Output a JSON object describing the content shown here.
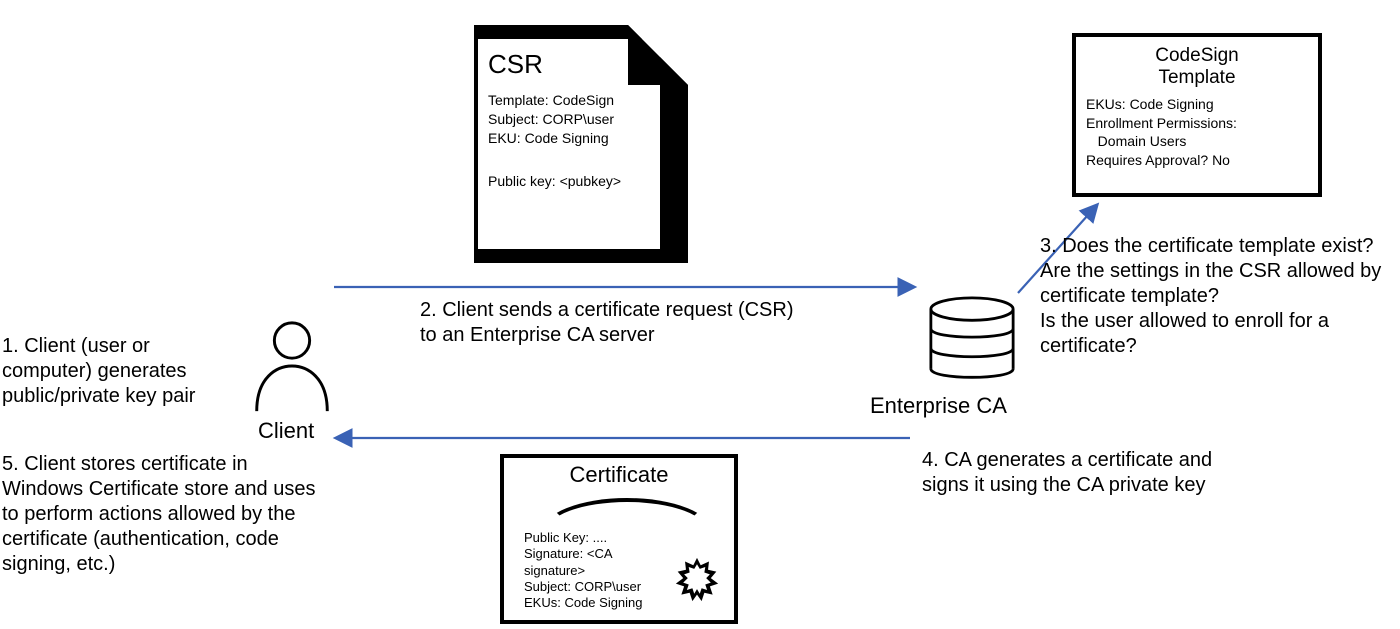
{
  "csr": {
    "title": "CSR",
    "template_line": "Template: CodeSign",
    "subject_line": "Subject: CORP\\user",
    "eku_line": "EKU: Code Signing",
    "pubkey_line": "Public key: <pubkey>"
  },
  "template_box": {
    "title_line1": "CodeSign",
    "title_line2": "Template",
    "eku_line": "EKUs: Code Signing",
    "perm_line1": "Enrollment Permissions:",
    "perm_line2": "   Domain Users",
    "approval_line": "Requires Approval? No"
  },
  "client_label": "Client",
  "ca_label": "Enterprise CA",
  "steps": {
    "s1": "1. Client (user or computer) generates public/private key pair",
    "s2": "2. Client sends a certificate request (CSR) to an Enterprise CA server",
    "s3a": "3. Does the certificate template exist?",
    "s3b": "Are the settings in the CSR allowed by certificate template?",
    "s3c": "Is the user allowed to enroll for a certificate?",
    "s4": "4. CA generates a certificate and signs it using the CA private key",
    "s5": "5. Client stores certificate in Windows Certificate store and uses to perform actions allowed by the certificate (authentication, code signing, etc.)"
  },
  "certificate": {
    "title": "Certificate",
    "pubkey_line": "Public Key: ....",
    "sig_line1": "Signature: <CA",
    "sig_line2": "signature>",
    "subject_line": "Subject: CORP\\user",
    "eku_line": "EKUs: Code Signing"
  },
  "colors": {
    "arrow": "#3a62b5"
  }
}
